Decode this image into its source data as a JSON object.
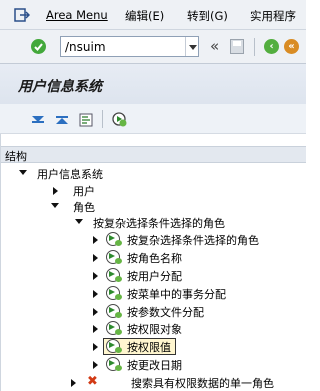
{
  "menubar": {
    "exit_icon": "exit-icon",
    "items": [
      {
        "label": "Area Menu"
      },
      {
        "label": "编辑(E)"
      },
      {
        "label": "转到(G)"
      },
      {
        "label": "实用程序"
      }
    ]
  },
  "toolbar": {
    "command_field": "/nsuim",
    "back_label": "«"
  },
  "title": "用户信息系统",
  "tree": {
    "header": "结构",
    "root": "用户信息系统",
    "users": "用户",
    "roles": "角色",
    "complex": "按复杂选择条件选择的角色",
    "items": [
      "按复杂选择条件选择的角色",
      "按角色名称",
      "按用户分配",
      "按菜单中的事务分配",
      "按参数文件分配",
      "按权限对象",
      "按权限值",
      "按更改日期"
    ],
    "selected_index": 6,
    "last": "搜索具有权限数据的单一角色"
  },
  "colors": {
    "accent_green": "#53ae3f",
    "selection": "#fff6cf",
    "error_red": "#d23a15"
  }
}
